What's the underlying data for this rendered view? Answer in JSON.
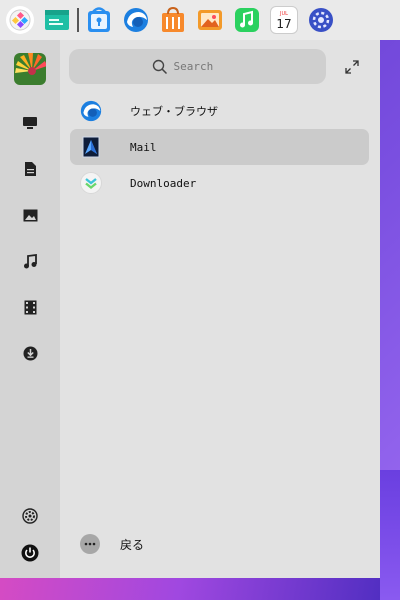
{
  "dock": {
    "icons": [
      {
        "name": "app-menu-icon"
      },
      {
        "name": "file-manager-icon"
      },
      {
        "name": "app-store-icon"
      },
      {
        "name": "web-browser-icon"
      },
      {
        "name": "shopping-bag-icon"
      },
      {
        "name": "photo-gallery-icon"
      },
      {
        "name": "music-icon"
      },
      {
        "name": "calendar-icon",
        "month": "JUL",
        "day": "17"
      },
      {
        "name": "settings-icon"
      }
    ]
  },
  "sidebar": {
    "items": [
      {
        "name": "computer-icon"
      },
      {
        "name": "documents-icon"
      },
      {
        "name": "pictures-icon"
      },
      {
        "name": "music-icon"
      },
      {
        "name": "videos-icon"
      },
      {
        "name": "downloads-icon"
      },
      {
        "name": "settings-icon"
      },
      {
        "name": "power-icon"
      }
    ]
  },
  "search": {
    "placeholder": "Search"
  },
  "apps": [
    {
      "label": "ウェブ・ブラウザ",
      "icon": "browser-icon"
    },
    {
      "label": "Mail",
      "icon": "mail-icon",
      "selected": true
    },
    {
      "label": "Downloader",
      "icon": "downloader-icon"
    }
  ],
  "footer": {
    "back_label": "戻る"
  },
  "colors": {
    "panel": "#e2e2e2",
    "sidebar": "#d4d4d4",
    "selected": "#cbcbcb",
    "accent": "#2a6fd8"
  }
}
